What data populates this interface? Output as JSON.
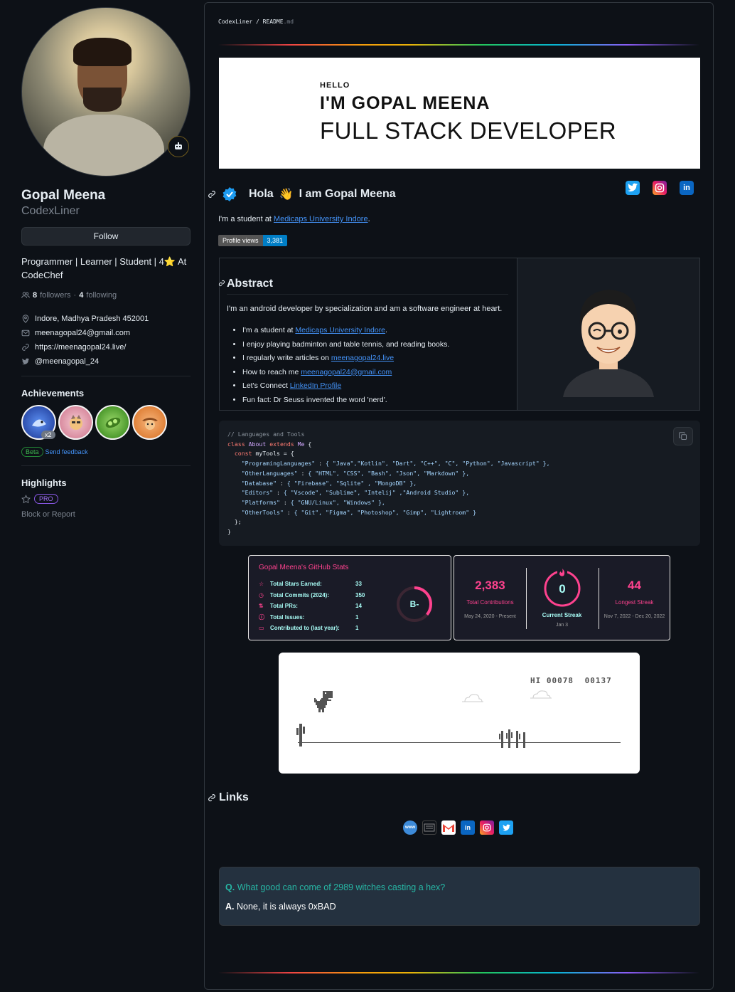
{
  "profile": {
    "name": "Gopal Meena",
    "login": "CodexLiner",
    "follow_label": "Follow",
    "bio": "Programmer | Learner | Student | 4⭐ At CodeChef",
    "followers_count": "8",
    "followers_label": "followers",
    "sep": "·",
    "following_count": "4",
    "following_label": "following",
    "location": "Indore, Madhya Pradesh 452001",
    "email": "meenagopal24@gmail.com",
    "website": "https://meenagopal24.live/",
    "twitter": "@meenagopal_24",
    "achievements_title": "Achievements",
    "achievement_count_badge": "x2",
    "beta_label": "Beta",
    "feedback_label": "Send feedback",
    "highlights_title": "Highlights",
    "pro_label": "PRO",
    "block_report": "Block or Report"
  },
  "readme": {
    "breadcrumb_repo": "CodexLiner",
    "breadcrumb_sep": "/",
    "breadcrumb_file": "README",
    "breadcrumb_ext": ".md",
    "banner": {
      "hello": "HELLO",
      "name": "I'M GOPAL MEENA",
      "role": "FULL STACK DEVELOPER"
    },
    "hola": "Hola",
    "wave": "👋",
    "iam": "I am Gopal Meena",
    "intro_prefix": "I'm a student at ",
    "intro_link": "Medicaps University Indore",
    "intro_suffix": ".",
    "profile_views_label": "Profile views",
    "profile_views_value": "3,381",
    "abstract_title": "Abstract",
    "abstract_desc": "I'm an android developer by specialization and am a software engineer at heart.",
    "abstract_items": [
      {
        "text": "I'm a student at ",
        "link": "Medicaps University Indore",
        "after": "."
      },
      {
        "text": "I enjoy playing badminton and table tennis, and reading books.",
        "link": "",
        "after": ""
      },
      {
        "text": "I regularly write articles on ",
        "link": "meenagopal24.live",
        "after": ""
      },
      {
        "text": "How to reach me ",
        "link": "meenagopal24@gmail.com",
        "after": ""
      },
      {
        "text": "Let's Connect ",
        "link": "LinkedIn Profile",
        "after": ""
      },
      {
        "text": "Fun fact: Dr Seuss invented the word 'nerd'.",
        "link": "",
        "after": ""
      }
    ],
    "code": {
      "comment": "// Languages and Tools",
      "kw_class": "class",
      "class_name": "About",
      "kw_extends": "extends",
      "parent": "Me",
      "kw_const": "const",
      "var": "myTools",
      "entries": [
        {
          "key": "\"ProgramingLanguages\"",
          "value": "{ \"Java\",\"Kotlin\", \"Dart\", \"C++\", \"C\", \"Python\", \"Javascript\" },"
        },
        {
          "key": "\"OtherLanguages\"",
          "value": "{ \"HTML\", \"CSS\", \"Bash\", \"Json\", \"Markdown\" },"
        },
        {
          "key": "\"Database\"",
          "value": "{ \"Firebase\", \"Sqlite\" , \"MongoDB\" },"
        },
        {
          "key": "\"Editors\"",
          "value": "{ \"Vscode\", \"Sublime\", \"Intelij\" ,\"Android Studio\" },"
        },
        {
          "key": "\"Platforms\"",
          "value": "{ \"GNU/Linux\", \"Windows\" },"
        },
        {
          "key": "\"OtherTools\"",
          "value": "{ \"Git\", \"Figma\", \"Photoshop\", \"Gimp\", \"Lightroom\" }"
        }
      ]
    },
    "stats": {
      "title": "Gopal Meena's GitHub Stats",
      "rows": [
        {
          "label": "Total Stars Earned:",
          "value": "33",
          "icon": "star-icon"
        },
        {
          "label": "Total Commits (2024):",
          "value": "350",
          "icon": "clock-icon"
        },
        {
          "label": "Total PRs:",
          "value": "14",
          "icon": "pr-icon"
        },
        {
          "label": "Total Issues:",
          "value": "1",
          "icon": "issue-icon"
        },
        {
          "label": "Contributed to (last year):",
          "value": "1",
          "icon": "repo-icon"
        }
      ],
      "grade": "B-",
      "grade_progress": 0.36,
      "colors": {
        "title": "#fe428e",
        "text": "#a9fef7",
        "bg": "#1a1b27"
      }
    },
    "streak": {
      "total": "2,383",
      "total_label": "Total Contributions",
      "total_range": "May 24, 2020 - Present",
      "current": "0",
      "current_label": "Current Streak",
      "current_range": "Jan 3",
      "longest": "44",
      "longest_label": "Longest Streak",
      "longest_range": "Nov 7, 2022 - Dec 20, 2022"
    },
    "dino": {
      "hi_label": "HI",
      "hi_score": "00078",
      "score": "00137"
    },
    "links_title": "Links",
    "joke": {
      "q_prefix": "Q.",
      "q": "What good can come of 2989 witches casting a hex?",
      "a_prefix": "A.",
      "a": "None, it is always 0xBAD"
    }
  }
}
